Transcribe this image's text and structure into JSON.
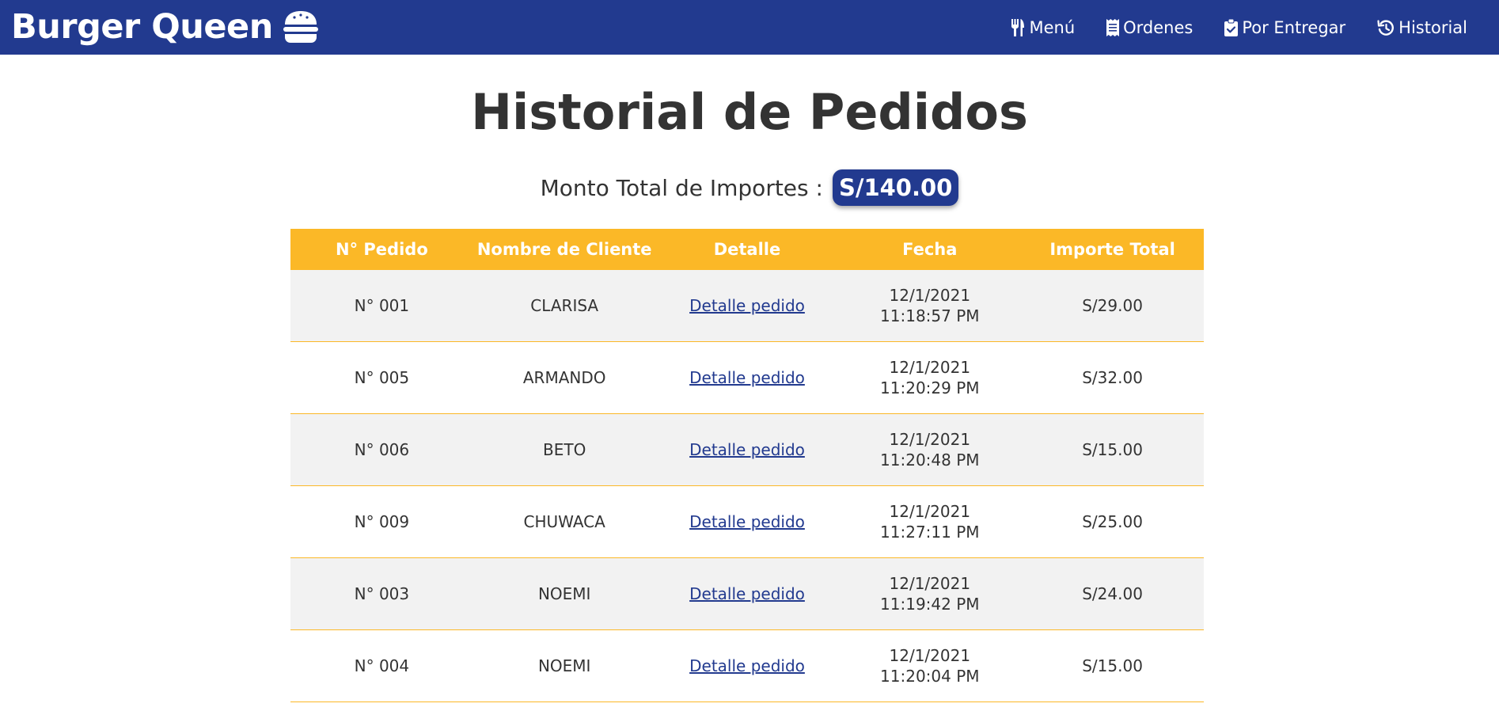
{
  "header": {
    "brand": "Burger Queen",
    "brand_icon": "burger-icon",
    "nav": [
      {
        "label": "Menú",
        "icon": "utensils-icon"
      },
      {
        "label": "Ordenes",
        "icon": "receipt-icon"
      },
      {
        "label": "Por Entregar",
        "icon": "clipboard-check-icon"
      },
      {
        "label": "Historial",
        "icon": "history-icon"
      }
    ]
  },
  "main": {
    "title": "Historial de Pedidos",
    "total_label": "Monto Total de Importes :",
    "total_value": "S/140.00"
  },
  "table": {
    "headers": [
      "N° Pedido",
      "Nombre de Cliente",
      "Detalle",
      "Fecha",
      "Importe Total"
    ],
    "rows": [
      {
        "pedido": "N° 001",
        "cliente": "CLARISA",
        "detalle": "Detalle pedido",
        "fecha": "12/1/2021 11:18:57 PM",
        "importe": "S/29.00"
      },
      {
        "pedido": "N° 005",
        "cliente": "ARMANDO",
        "detalle": "Detalle pedido",
        "fecha": "12/1/2021 11:20:29 PM",
        "importe": "S/32.00"
      },
      {
        "pedido": "N° 006",
        "cliente": "BETO",
        "detalle": "Detalle pedido",
        "fecha": "12/1/2021 11:20:48 PM",
        "importe": "S/15.00"
      },
      {
        "pedido": "N° 009",
        "cliente": "CHUWACA",
        "detalle": "Detalle pedido",
        "fecha": "12/1/2021 11:27:11 PM",
        "importe": "S/25.00"
      },
      {
        "pedido": "N° 003",
        "cliente": "NOEMI",
        "detalle": "Detalle pedido",
        "fecha": "12/1/2021 11:19:42 PM",
        "importe": "S/24.00"
      },
      {
        "pedido": "N° 004",
        "cliente": "NOEMI",
        "detalle": "Detalle pedido",
        "fecha": "12/1/2021 11:20:04 PM",
        "importe": "S/15.00"
      }
    ]
  },
  "colors": {
    "primary": "#223a8f",
    "accent": "#fbb827",
    "row_alt": "#f2f2f2",
    "text": "#333333"
  }
}
